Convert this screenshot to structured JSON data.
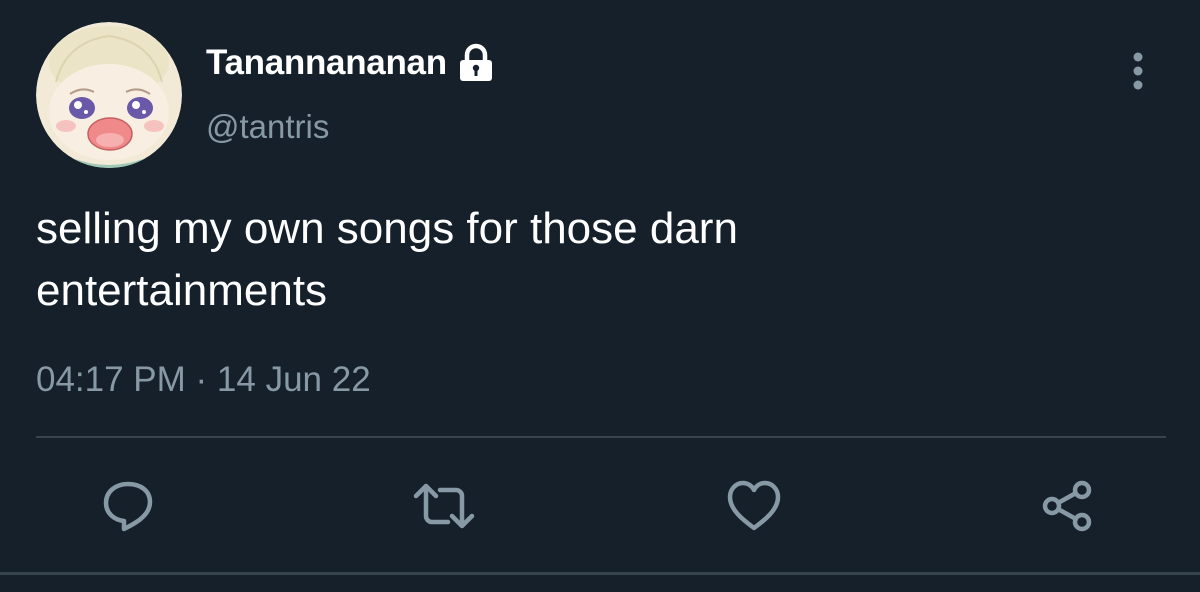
{
  "user": {
    "display_name": "Tanannananan",
    "handle": "@tantris",
    "protected": true
  },
  "tweet": {
    "text_line1": "selling my own songs for those darn",
    "text_line2": "entertainments",
    "time": "04:17 PM",
    "separator": " · ",
    "date": "14 Jun 22"
  },
  "icons": {
    "lock": "lock-icon",
    "more": "more-vertical-icon",
    "reply": "reply-icon",
    "retweet": "retweet-icon",
    "like": "heart-icon",
    "share": "share-icon"
  },
  "colors": {
    "background": "#15202b",
    "primary_text": "#ffffff",
    "secondary_text": "#8899a6",
    "divider": "#38444d"
  }
}
